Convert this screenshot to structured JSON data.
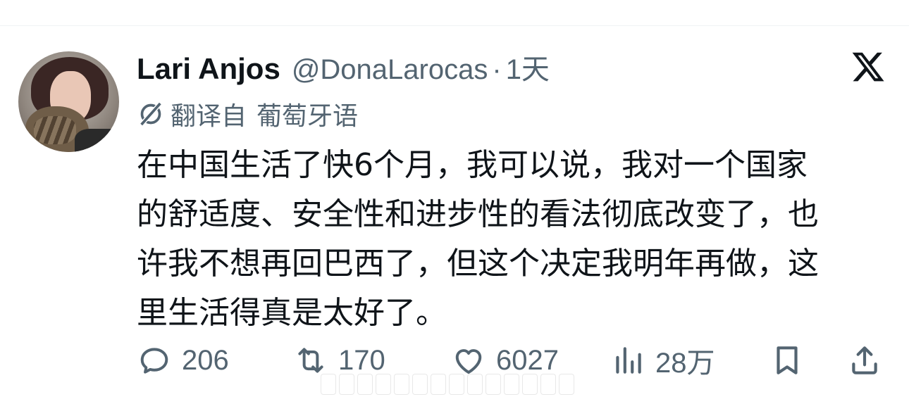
{
  "tweet": {
    "display_name": "Lari Anjos",
    "handle": "@DonaLarocas",
    "separator": "·",
    "time": "1天",
    "translated_from_label": "翻译自",
    "source_language": "葡萄牙语",
    "text_lines": [
      "在中国生活了快6个月，我可以说，我对一个国家",
      "的舒适度、安全性和进步性的看法彻底改变了，也",
      "许我不想再回巴西了，但这个决定我明年再做，这",
      "里生活得真是太好了。"
    ]
  },
  "actions": {
    "replies": "206",
    "retweets": "170",
    "likes": "6027",
    "views": "28万"
  },
  "icons": {
    "logo": "x-logo-icon",
    "translate": "translate-icon",
    "reply": "reply-icon",
    "retweet": "retweet-icon",
    "like": "heart-icon",
    "views": "views-chart-icon",
    "bookmark": "bookmark-icon",
    "share": "share-icon"
  },
  "colors": {
    "text": "#0f1419",
    "secondary": "#536471",
    "divider": "#eff3f4"
  }
}
